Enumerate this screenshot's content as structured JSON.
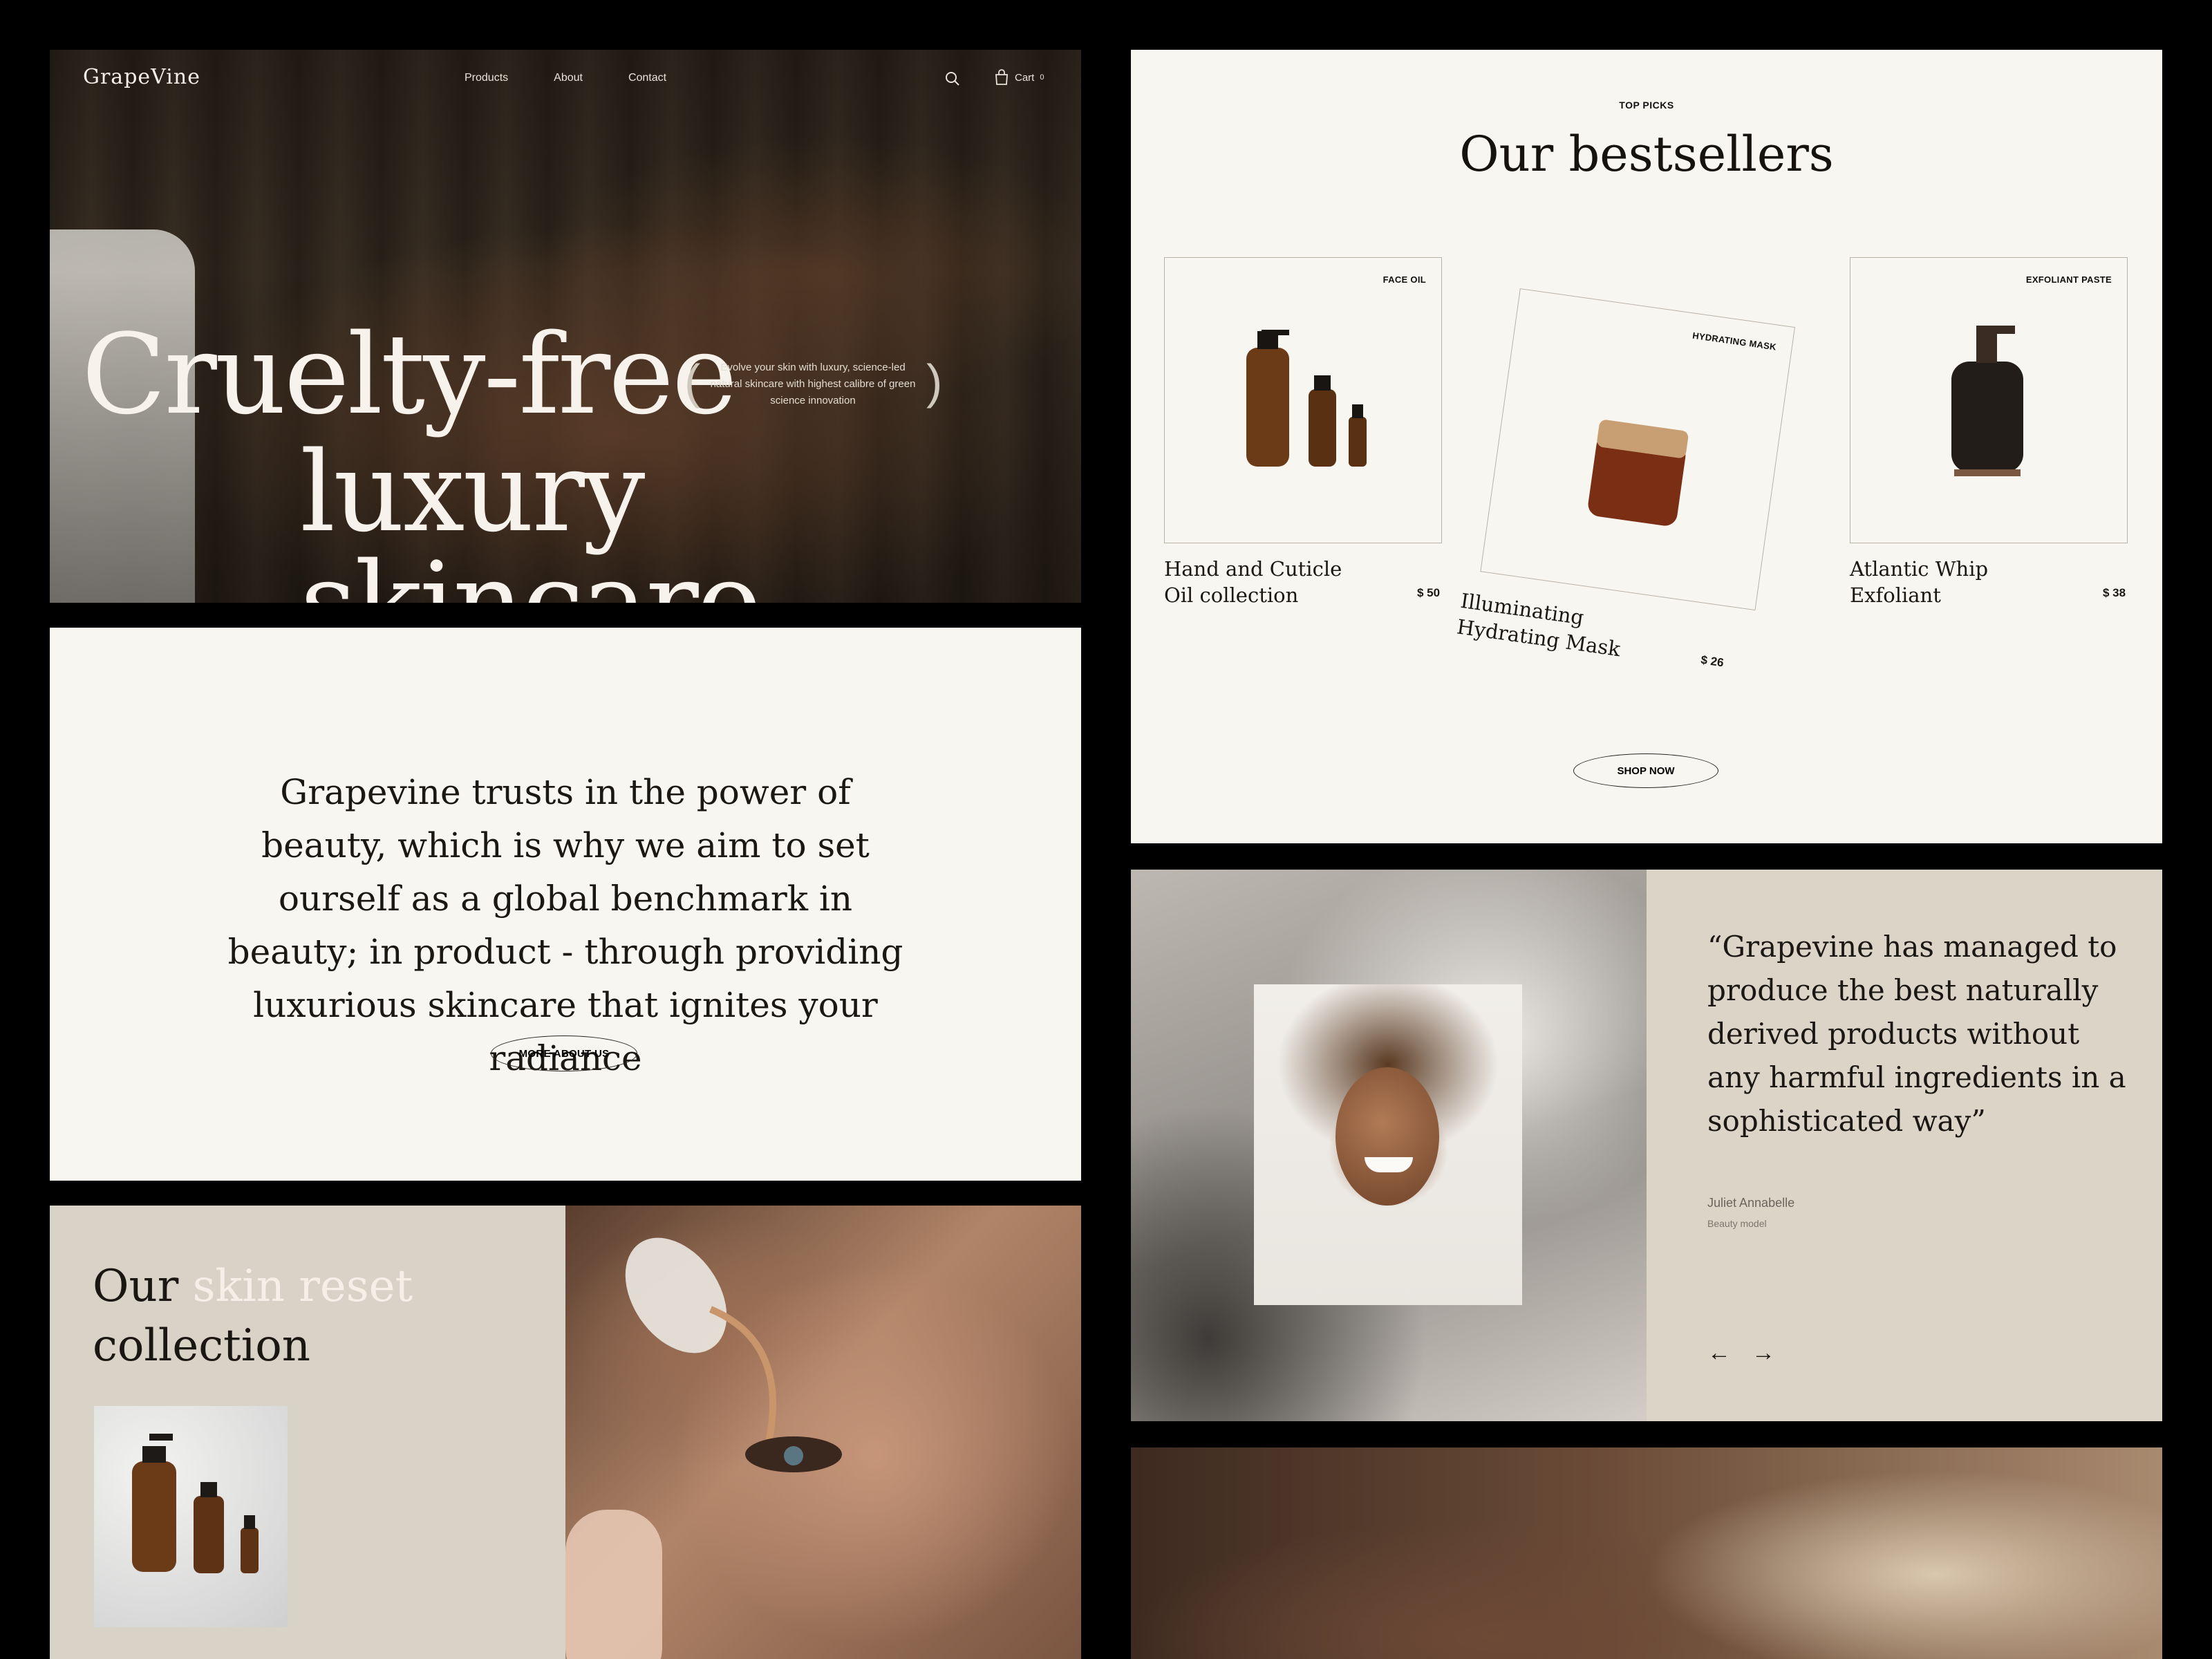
{
  "hero": {
    "logo": "GrapeVine",
    "nav": [
      "Products",
      "About",
      "Contact"
    ],
    "cart_label": "Cart",
    "cart_count": "0",
    "headline_line1": "Cruelty-free",
    "headline_line2": "luxury skincare",
    "tagline": "Evolve your skin with luxury, science-led natural skincare with highest calibre of green science innovation"
  },
  "statement": {
    "text": "Grapevine trusts in the power of beauty, which is why we aim to set ourself as a global benchmark in beauty; in product - through providing luxurious skincare that ignites your radiance",
    "button": "MORE ABOUT US"
  },
  "collection": {
    "title_part1": "Our ",
    "title_highlight": "skin reset",
    "title_part2": "collection"
  },
  "bestsellers": {
    "kicker": "TOP PICKS",
    "heading": "Our bestsellers",
    "products": [
      {
        "tag": "FACE OIL",
        "name_line1": "Hand and Cuticle",
        "name_line2": "Oil collection",
        "price": "$ 50"
      },
      {
        "tag": "HYDRATING MASK",
        "name_line1": "Illuminating",
        "name_line2": "Hydrating Mask",
        "price": "$ 26"
      },
      {
        "tag": "EXFOLIANT PASTE",
        "name_line1": "Atlantic Whip",
        "name_line2": "Exfoliant",
        "price": "$ 38"
      }
    ],
    "button": "SHOP NOW"
  },
  "testimonial": {
    "quote": "“Grapevine has managed to produce the best naturally derived products without any harmful ingredients in a sophisticated way”",
    "author": "Juliet Annabelle",
    "role": "Beauty model",
    "prev": "←",
    "next": "→"
  },
  "colors": {
    "cream": "#f8f6f0",
    "beige": "#dbd4c7",
    "dark": "#1b1814",
    "amber": "#6b3a17"
  }
}
